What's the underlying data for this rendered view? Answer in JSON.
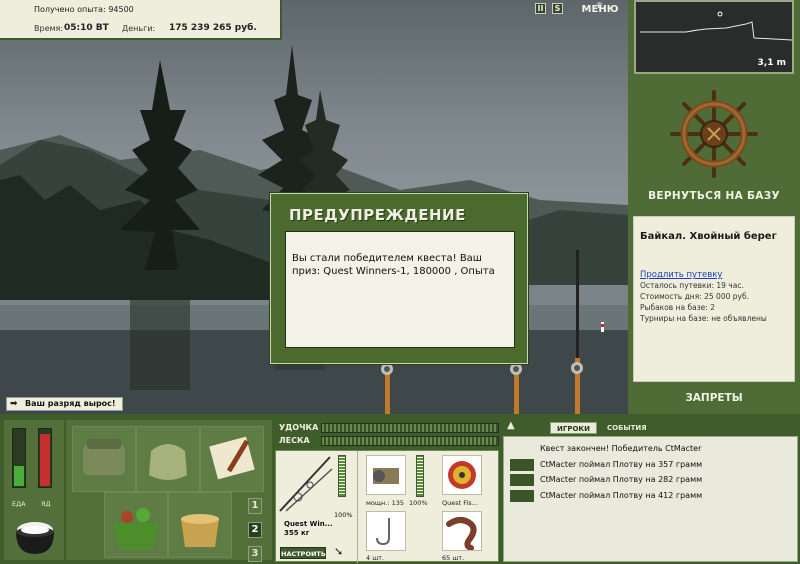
{
  "hud": {
    "experience_text": "Получено опыта: 94500",
    "time_label": "Время:",
    "time_value": "05:10 ВТ",
    "money_label": "Деньги:",
    "money_value": "175 239 265 руб.",
    "pause_glyph": "II",
    "sound_glyph": "S",
    "menu_label": "МЕНЮ"
  },
  "depth": {
    "value": "3,1 m"
  },
  "sidebar": {
    "back_to_base": "ВЕРНУТЬСЯ НА БАЗУ",
    "location_title": "Байкал. Хвойный берег",
    "extend_link": "Продлить путевку",
    "remaining": "Осталось путевки: 19 час.",
    "day_cost": "Стоимость дня: 25 000 руб.",
    "fishers": "Рыбаков на базе: 2",
    "tournaments": "Турниры на базе: не объявлены",
    "bans": "ЗАПРЕТЫ"
  },
  "dialog": {
    "title": "ПРЕДУПРЕЖДЕНИЕ",
    "message": "Вы стали победителем квеста! Ваш приз: Quest Winners-1, 180000 , Опыта"
  },
  "rank_notice": "Ваш разряд вырос!",
  "needs": {
    "food_label": "ЕДА",
    "poison_label": "ЯД",
    "food_level": 0.35,
    "poison_level": 0.9
  },
  "inventory": {
    "pages": [
      "1",
      "2",
      "3"
    ],
    "active_page": "2"
  },
  "gear": {
    "rod_label": "УДОЧКА",
    "line_label": "ЛЕСКА",
    "rod_name": "Quest Win...",
    "rod_weight": "355 кг",
    "rod_condition": "100%",
    "reel_power": "мощн.: 135",
    "reel_condition": "100%",
    "line_name": "Quest Fis...",
    "hooks_count": "4 шт.",
    "bait_count": "65 шт.",
    "setup_button": "НАСТРОИТЬ"
  },
  "events": {
    "tabs": [
      "ИГРОКИ",
      "СОБЫТИЯ"
    ],
    "active_tab": "ИГРОКИ",
    "log": [
      {
        "text": "Квест закончен! Победитель CtMacter",
        "fish": false
      },
      {
        "text": "CtMacter поймал Плотву на 357 грамм",
        "fish": true
      },
      {
        "text": "CtMacter поймал Плотву на 282 грамм",
        "fish": true
      },
      {
        "text": "CtMacter поймал Плотву на 412 грамм",
        "fish": true
      }
    ]
  }
}
